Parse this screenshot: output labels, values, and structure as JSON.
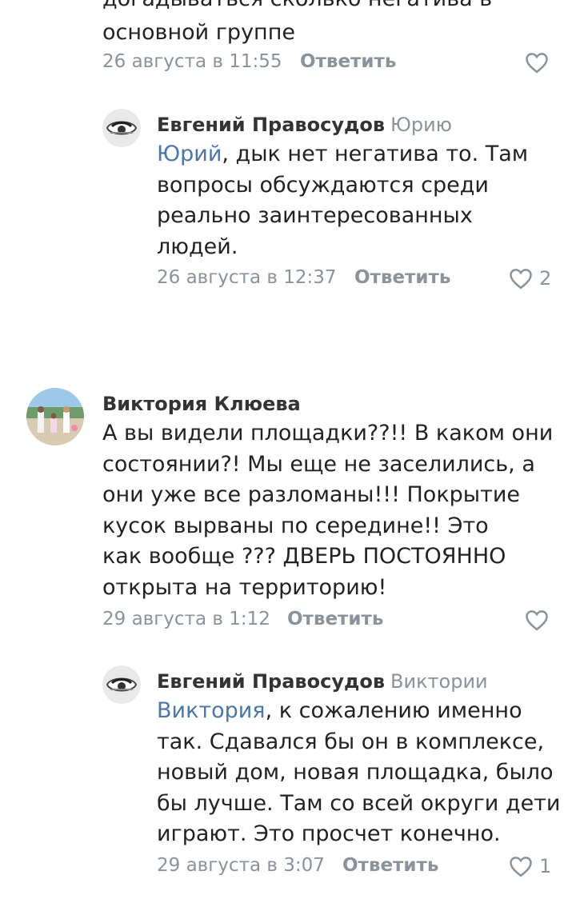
{
  "comments": [
    {
      "author": "",
      "text_lines": [
        "догадываться сколько негатива в",
        "основной группе"
      ],
      "date": "26 августа в 11:55",
      "reply_label": "Ответить",
      "likes": ""
    },
    {
      "author": "Евгений Правосудов",
      "reply_to": "Юрию",
      "mention": "Юрий",
      "text_rest": ", дык нет негатива то. Там\nвопросы обсуждаются среди\nреально заинтересованных\nлюдей.",
      "date": "26 августа в 12:37",
      "reply_label": "Ответить",
      "likes": "2"
    },
    {
      "author": "Виктория Клюева",
      "text": "А вы видели площадки??!! В каком они\nсостоянии?! Мы еще не заселились, а\nони уже все разломаны!!! Покрытие\nкусок вырваны по середине!! Это\nкак вообще ??? ДВЕРЬ ПОСТОЯННО\nоткрыта на территорию!",
      "date": "29 августа в 1:12",
      "reply_label": "Ответить",
      "likes": ""
    },
    {
      "author": "Евгений Правосудов",
      "reply_to": "Виктории",
      "mention": "Виктория",
      "text_rest": ", к сожалению именно\nтак. Сдавался бы он в комплексе,\nновый дом, новая площадка, было\nбы лучше. Там со всей округи дети\nиграют. Это просчет конечно.",
      "date": "29 августа в 3:07",
      "reply_label": "Ответить",
      "likes": "1"
    }
  ],
  "colors": {
    "text": "#222222",
    "meta": "#8a929b",
    "link": "#4a76a8"
  },
  "icons": {
    "like": "heart-outline-icon"
  }
}
